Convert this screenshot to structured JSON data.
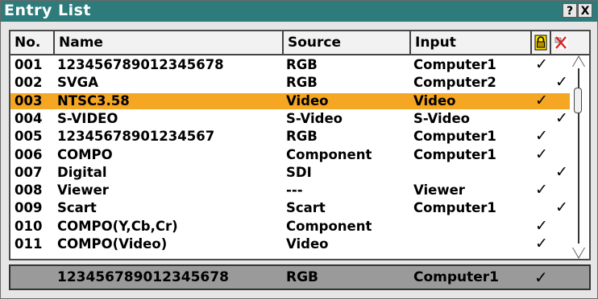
{
  "window": {
    "title": "Entry List",
    "help_label": "?",
    "close_label": "X"
  },
  "columns": {
    "no": "No.",
    "name": "Name",
    "source": "Source",
    "input": "Input"
  },
  "icons": {
    "lock": "lock-icon",
    "delete": "delete-icon",
    "check": "✓"
  },
  "selected_index": 2,
  "rows": [
    {
      "no": "001",
      "name": "123456789012345678",
      "source": "RGB",
      "input": "Computer1",
      "lock": true,
      "skip": false
    },
    {
      "no": "002",
      "name": "SVGA",
      "source": "RGB",
      "input": "Computer2",
      "lock": false,
      "skip": true
    },
    {
      "no": "003",
      "name": "NTSC3.58",
      "source": "Video",
      "input": "Video",
      "lock": true,
      "skip": false
    },
    {
      "no": "004",
      "name": "S-VIDEO",
      "source": "S-Video",
      "input": "S-Video",
      "lock": false,
      "skip": true
    },
    {
      "no": "005",
      "name": "12345678901234567",
      "source": "RGB",
      "input": "Computer1",
      "lock": true,
      "skip": false
    },
    {
      "no": "006",
      "name": "COMPO",
      "source": "Component",
      "input": "Computer1",
      "lock": true,
      "skip": false
    },
    {
      "no": "007",
      "name": "Digital",
      "source": "SDI",
      "input": "",
      "lock": false,
      "skip": true
    },
    {
      "no": "008",
      "name": "Viewer",
      "source": "---",
      "input": "Viewer",
      "lock": true,
      "skip": false
    },
    {
      "no": "009",
      "name": "Scart",
      "source": "Scart",
      "input": "Computer1",
      "lock": false,
      "skip": true
    },
    {
      "no": "010",
      "name": "COMPO(Y,Cb,Cr)",
      "source": "Component",
      "input": "",
      "lock": true,
      "skip": false
    },
    {
      "no": "011",
      "name": "COMPO(Video)",
      "source": "Video",
      "input": "",
      "lock": true,
      "skip": false
    }
  ],
  "footer": {
    "name": "123456789012345678",
    "source": "RGB",
    "input": "Computer1",
    "lock": true
  },
  "colors": {
    "titlebar": "#2e7b7b",
    "selection": "#f5a623",
    "footer": "#9a9a9a"
  }
}
